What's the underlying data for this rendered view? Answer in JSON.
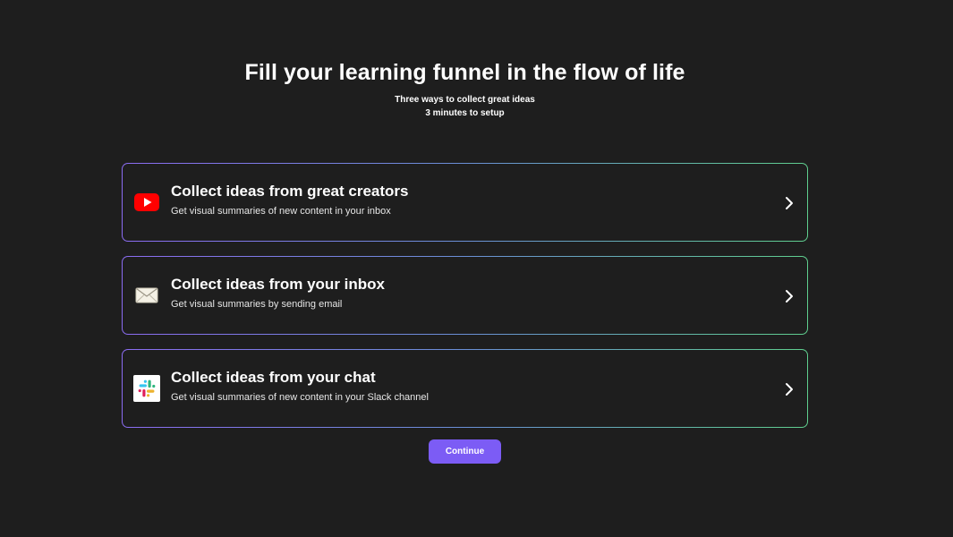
{
  "header": {
    "title": "Fill your learning funnel in the flow of life",
    "subtitle_line1": "Three ways to collect great ideas",
    "subtitle_line2": "3 minutes to setup"
  },
  "options": [
    {
      "title": "Collect ideas from great creators",
      "description": "Get visual summaries of new content in your inbox",
      "icon": "youtube-icon"
    },
    {
      "title": "Collect ideas from your inbox",
      "description": "Get visual summaries by sending email",
      "icon": "envelope-icon"
    },
    {
      "title": "Collect ideas from your chat",
      "description": "Get visual summaries of new content in your Slack channel",
      "icon": "slack-icon"
    }
  ],
  "continue_label": "Continue",
  "colors": {
    "background": "#1e1e1e",
    "accent": "#7c5cf5",
    "border_gradient_start": "#8b6cf2",
    "border_gradient_end": "#5fcf8e",
    "youtube_red": "#ff0000"
  }
}
